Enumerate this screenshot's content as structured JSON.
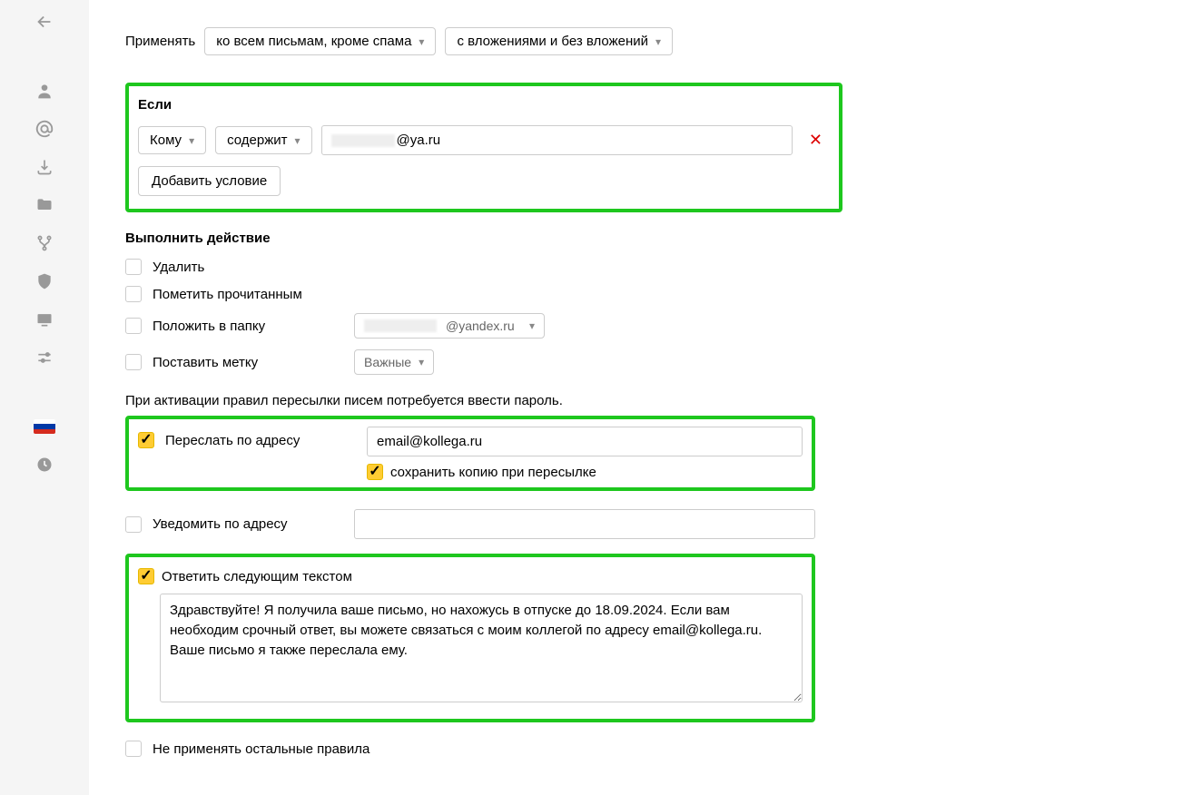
{
  "sidebar": {
    "icons": [
      "back",
      "user",
      "at",
      "download",
      "folder",
      "fork",
      "shield",
      "monitor",
      "sliders",
      "flag",
      "clock"
    ]
  },
  "apply": {
    "label": "Применять",
    "scope": "ко всем письмам, кроме спама",
    "attachments": "с вложениями и без вложений"
  },
  "condition": {
    "title": "Если",
    "field": "Кому",
    "operator": "содержит",
    "value_suffix": "@ya.ru",
    "value_full": "@ya.ru",
    "add_button": "Добавить условие"
  },
  "actions": {
    "title": "Выполнить действие",
    "delete": {
      "label": "Удалить",
      "checked": false
    },
    "mark_read": {
      "label": "Пометить прочитанным",
      "checked": false
    },
    "move": {
      "label": "Положить в папку",
      "checked": false,
      "folder_suffix": "@yandex.ru"
    },
    "label": {
      "label": "Поставить метку",
      "checked": false,
      "tag": "Важные"
    }
  },
  "forward_hint": "При активации правил пересылки писем потребуется ввести пароль.",
  "forward": {
    "label": "Переслать по адресу",
    "checked": true,
    "value": "email@kollega.ru",
    "save_copy": {
      "label": "сохранить копию при пересылке",
      "checked": true
    }
  },
  "notify": {
    "label": "Уведомить по адресу",
    "checked": false,
    "value": ""
  },
  "autoreply": {
    "label": "Ответить следующим текстом",
    "checked": true,
    "text": "Здравствуйте! Я получила ваше письмо, но нахожусь в отпуске до 18.09.2024. Если вам необходим срочный ответ, вы можете связаться с моим коллегой по адресу email@kollega.ru. Ваше письмо я также переслала ему."
  },
  "skip_others": {
    "label": "Не применять остальные правила",
    "checked": false
  }
}
